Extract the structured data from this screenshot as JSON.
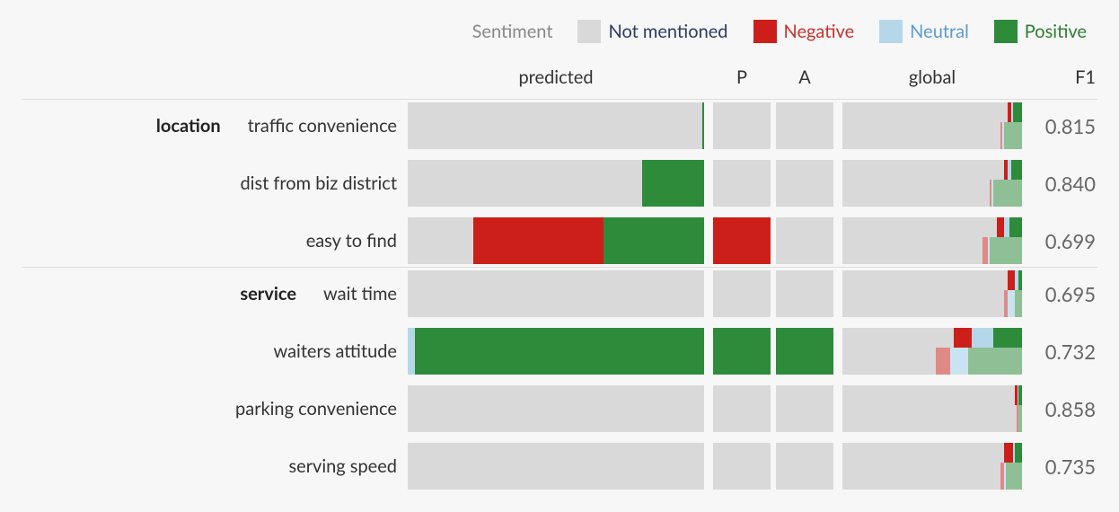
{
  "legend": {
    "title": "Sentiment",
    "items": [
      {
        "id": "not_mentioned",
        "label": "Not mentioned",
        "label_color": "#2d3b66",
        "swatch": "#d9d9d9"
      },
      {
        "id": "negative",
        "label": "Negative",
        "label_color": "#c9302c",
        "swatch": "#cc1f1a"
      },
      {
        "id": "neutral",
        "label": "Neutral",
        "label_color": "#5b9bd5",
        "swatch": "#b6d7ea"
      },
      {
        "id": "positive",
        "label": "Positive",
        "label_color": "#2e7d32",
        "swatch": "#2e8b3a"
      }
    ]
  },
  "headers": {
    "predicted": "predicted",
    "P": "P",
    "A": "A",
    "global": "global",
    "F1": "F1"
  },
  "colors": {
    "not_mentioned": "#d9d9d9",
    "negative": "#cc1f1a",
    "neutral": "#b6d7ea",
    "positive": "#2e8b3a",
    "positive_muted": "#8fc095",
    "negative_muted": "#e08a87",
    "neutral_muted": "#c9e3f0"
  },
  "chart_data": {
    "type": "table",
    "title": "",
    "columns": [
      "group",
      "aspect",
      "predicted",
      "P",
      "A",
      "global_top",
      "global_bot",
      "F1"
    ],
    "segment_order": [
      "not_mentioned",
      "negative",
      "neutral",
      "positive"
    ],
    "rows": [
      {
        "group": "location",
        "aspect": "traffic convenience",
        "predicted": {
          "not_mentioned": 99.5,
          "negative": 0,
          "neutral": 0,
          "positive": 0.5
        },
        "P": {
          "not_mentioned": 100,
          "negative": 0,
          "neutral": 0,
          "positive": 0
        },
        "A": {
          "not_mentioned": 100,
          "negative": 0,
          "neutral": 0,
          "positive": 0
        },
        "global_top": {
          "not_mentioned": 92,
          "negative": 2,
          "neutral": 1,
          "positive": 5
        },
        "global_bot": {
          "not_mentioned": 88,
          "negative": 1,
          "neutral": 1,
          "positive": 10
        },
        "F1": 0.815
      },
      {
        "group": "",
        "aspect": "dist from biz district",
        "predicted": {
          "not_mentioned": 79,
          "negative": 0,
          "neutral": 0,
          "positive": 21
        },
        "P": {
          "not_mentioned": 100,
          "negative": 0,
          "neutral": 0,
          "positive": 0
        },
        "A": {
          "not_mentioned": 100,
          "negative": 0,
          "neutral": 0,
          "positive": 0
        },
        "global_top": {
          "not_mentioned": 90,
          "negative": 2,
          "neutral": 2,
          "positive": 6
        },
        "global_bot": {
          "not_mentioned": 82,
          "negative": 1,
          "neutral": 1,
          "positive": 16
        },
        "F1": 0.84
      },
      {
        "group": "",
        "aspect": "easy to find",
        "predicted": {
          "not_mentioned": 22,
          "negative": 44,
          "neutral": 0,
          "positive": 34
        },
        "P": {
          "not_mentioned": 0,
          "negative": 100,
          "neutral": 0,
          "positive": 0
        },
        "A": {
          "not_mentioned": 100,
          "negative": 0,
          "neutral": 0,
          "positive": 0
        },
        "global_top": {
          "not_mentioned": 86,
          "negative": 4,
          "neutral": 3,
          "positive": 7
        },
        "global_bot": {
          "not_mentioned": 78,
          "negative": 3,
          "neutral": 1,
          "positive": 18
        },
        "F1": 0.699
      },
      {
        "group": "service",
        "aspect": "wait time",
        "predicted": {
          "not_mentioned": 100,
          "negative": 0,
          "neutral": 0,
          "positive": 0
        },
        "P": {
          "not_mentioned": 100,
          "negative": 0,
          "neutral": 0,
          "positive": 0
        },
        "A": {
          "not_mentioned": 100,
          "negative": 0,
          "neutral": 0,
          "positive": 0
        },
        "global_top": {
          "not_mentioned": 92,
          "negative": 4,
          "neutral": 2,
          "positive": 2
        },
        "global_bot": {
          "not_mentioned": 90,
          "negative": 2,
          "neutral": 4,
          "positive": 4
        },
        "F1": 0.695
      },
      {
        "group": "",
        "aspect": "waiters attitude",
        "predicted": {
          "not_mentioned": 0,
          "negative": 0,
          "neutral": 2.5,
          "positive": 97.5
        },
        "P": {
          "not_mentioned": 0,
          "negative": 0,
          "neutral": 0,
          "positive": 100
        },
        "A": {
          "not_mentioned": 0,
          "negative": 0,
          "neutral": 0,
          "positive": 100
        },
        "global_top": {
          "not_mentioned": 62,
          "negative": 10,
          "neutral": 12,
          "positive": 16
        },
        "global_bot": {
          "not_mentioned": 52,
          "negative": 8,
          "neutral": 10,
          "positive": 30
        },
        "F1": 0.732
      },
      {
        "group": "",
        "aspect": "parking convenience",
        "predicted": {
          "not_mentioned": 100,
          "negative": 0,
          "neutral": 0,
          "positive": 0
        },
        "P": {
          "not_mentioned": 100,
          "negative": 0,
          "neutral": 0,
          "positive": 0
        },
        "A": {
          "not_mentioned": 100,
          "negative": 0,
          "neutral": 0,
          "positive": 0
        },
        "global_top": {
          "not_mentioned": 96,
          "negative": 1.5,
          "neutral": 0.5,
          "positive": 2
        },
        "global_bot": {
          "not_mentioned": 97,
          "negative": 1,
          "neutral": 0,
          "positive": 2
        },
        "F1": 0.858
      },
      {
        "group": "",
        "aspect": "serving speed",
        "predicted": {
          "not_mentioned": 100,
          "negative": 0,
          "neutral": 0,
          "positive": 0
        },
        "P": {
          "not_mentioned": 100,
          "negative": 0,
          "neutral": 0,
          "positive": 0
        },
        "A": {
          "not_mentioned": 100,
          "negative": 0,
          "neutral": 0,
          "positive": 0
        },
        "global_top": {
          "not_mentioned": 90,
          "negative": 5,
          "neutral": 1,
          "positive": 4
        },
        "global_bot": {
          "not_mentioned": 88,
          "negative": 2,
          "neutral": 1,
          "positive": 9
        },
        "F1": 0.735
      }
    ]
  }
}
